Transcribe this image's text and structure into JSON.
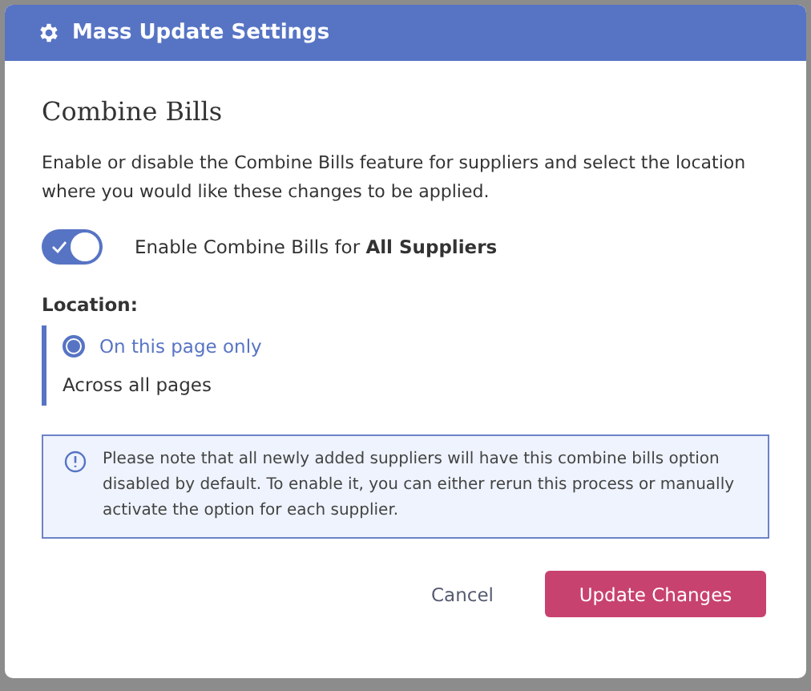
{
  "dialog": {
    "title": "Mass Update Settings"
  },
  "heading": "Combine Bills",
  "description": "Enable or disable the Combine Bills feature for suppliers and select the location where you would like these changes to be applied.",
  "toggle": {
    "label": "Enable Combine Bills for **All Suppliers**",
    "on": true
  },
  "location": {
    "label": "Location:",
    "options": [
      {
        "label": "On this page only",
        "selected": true
      },
      {
        "label": "Across all pages",
        "selected": false
      }
    ]
  },
  "notice": "Please note that all newly added suppliers will have this combine bills option disabled by default. To enable it, you can either rerun this process or manually activate the option for each supplier.",
  "buttons": [
    {
      "kind": "secondary",
      "label": "Cancel"
    },
    {
      "kind": "primary",
      "label": "Update Changes"
    }
  ]
}
